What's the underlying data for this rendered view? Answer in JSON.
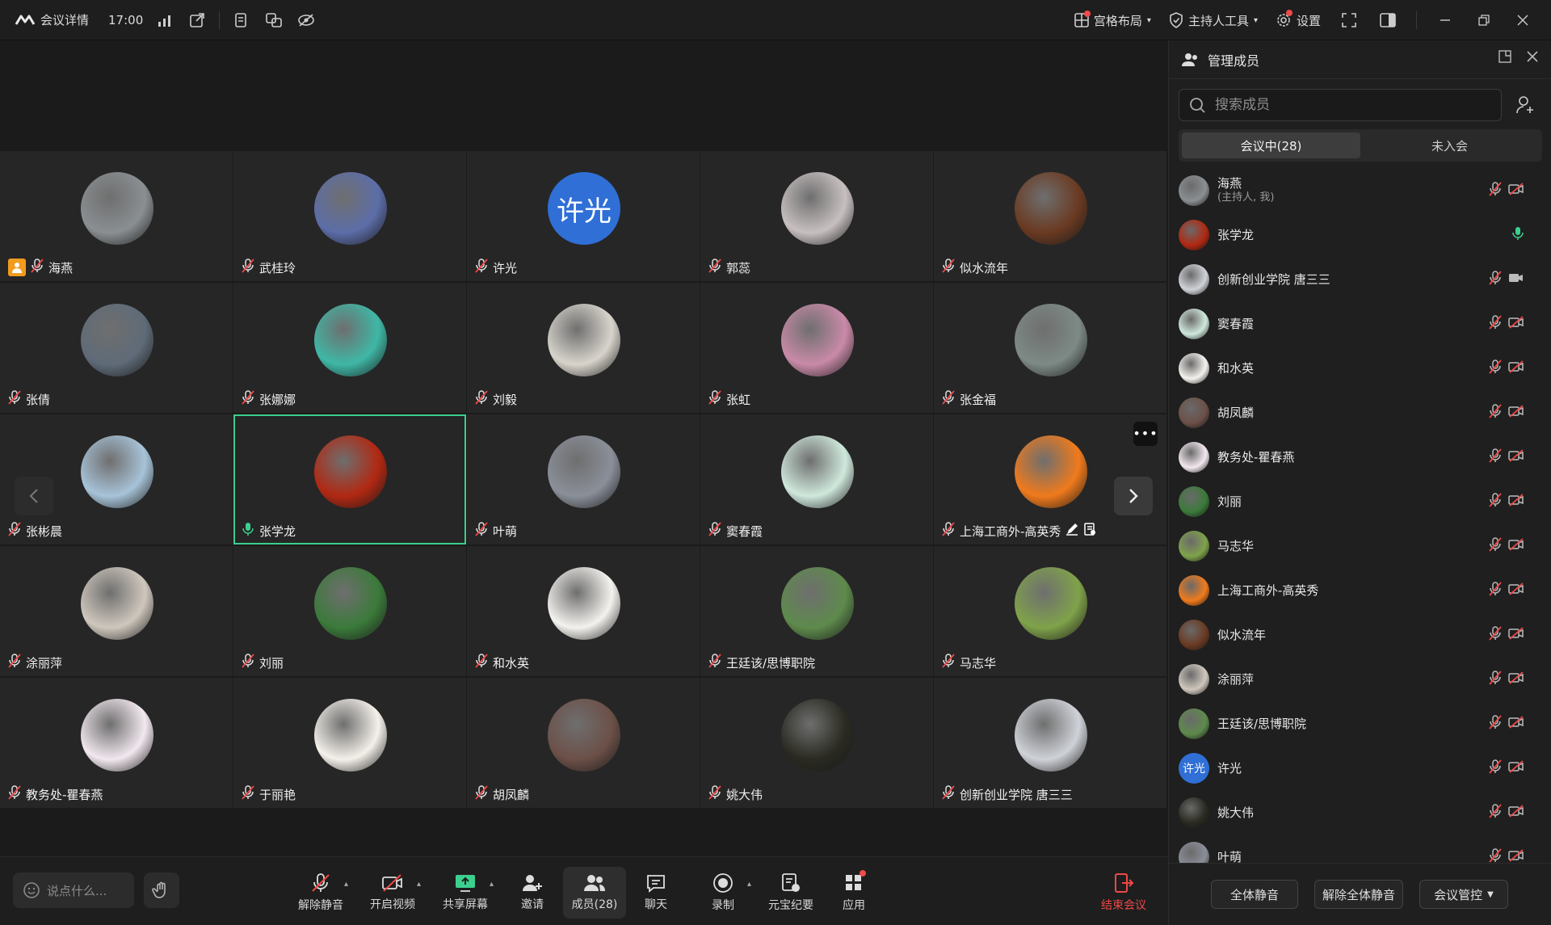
{
  "topbar": {
    "meeting_info": "会议详情",
    "time": "17:00",
    "layout": "宫格布局",
    "host_tools": "主持人工具",
    "settings": "设置"
  },
  "tiles": [
    {
      "name": "海燕",
      "color": "#8a8f92",
      "initials": "",
      "host": true
    },
    {
      "name": "武桂玲",
      "color": "#5c6da8",
      "initials": ""
    },
    {
      "name": "许光",
      "color": "#2f6fd6",
      "initials": "许光"
    },
    {
      "name": "郭蕊",
      "color": "#c8c0c0",
      "initials": ""
    },
    {
      "name": "似水流年",
      "color": "#6a3a22",
      "initials": ""
    },
    {
      "name": "张倩",
      "color": "#5f6b78",
      "initials": ""
    },
    {
      "name": "张娜娜",
      "color": "#3fb7a6",
      "initials": ""
    },
    {
      "name": "刘毅",
      "color": "#d8d4cc",
      "initials": ""
    },
    {
      "name": "张虹",
      "color": "#c98aa8",
      "initials": ""
    },
    {
      "name": "张金福",
      "color": "#7d8a86",
      "initials": ""
    },
    {
      "name": "张彬晨",
      "color": "#a7c3d8",
      "initials": ""
    },
    {
      "name": "张学龙",
      "color": "#b12812",
      "initials": "",
      "active": true,
      "speaking": true
    },
    {
      "name": "叶萌",
      "color": "#8a8f99",
      "initials": ""
    },
    {
      "name": "窦春霞",
      "color": "#cfe8dc",
      "initials": ""
    },
    {
      "name": "上海工商外-高英秀",
      "color": "#f07a1c",
      "initials": "",
      "extras": true
    },
    {
      "name": "涂丽萍",
      "color": "#cfc7bd",
      "initials": ""
    },
    {
      "name": "刘丽",
      "color": "#3b7a3a",
      "initials": ""
    },
    {
      "name": "和水英",
      "color": "#f4f2ee",
      "initials": ""
    },
    {
      "name": "王廷该/思博职院",
      "color": "#5e8a4c",
      "initials": ""
    },
    {
      "name": "马志华",
      "color": "#7fa24a",
      "initials": ""
    },
    {
      "name": "教务处-瞿春燕",
      "color": "#f2e8ef",
      "initials": ""
    },
    {
      "name": "于丽艳",
      "color": "#f4f0ea",
      "initials": ""
    },
    {
      "name": "胡凤麟",
      "color": "#6c5048",
      "initials": ""
    },
    {
      "name": "姚大伟",
      "color": "#2a2a22",
      "initials": ""
    },
    {
      "name": "创新创业学院 唐三三",
      "color": "#cfd2d8",
      "initials": ""
    }
  ],
  "bottom": {
    "chat_placeholder": "说点什么...",
    "unmute": "解除静音",
    "video": "开启视频",
    "share": "共享屏幕",
    "invite": "邀请",
    "members": "成员(28)",
    "chat": "聊天",
    "record": "录制",
    "summary": "元宝纪要",
    "apps": "应用",
    "end": "结束会议"
  },
  "panel": {
    "title": "管理成员",
    "search_placeholder": "搜索成员",
    "tab_in": "会议中(28)",
    "tab_out": "未入会",
    "mute_all": "全体静音",
    "unmute_all": "解除全体静音",
    "control": "会议管控",
    "members": [
      {
        "name": "海燕",
        "sub": "(主持人, 我)",
        "color": "#8a8f92",
        "initials": "",
        "mic": "muted",
        "cam": "off"
      },
      {
        "name": "张学龙",
        "sub": "",
        "color": "#b12812",
        "initials": "",
        "mic": "on",
        "cam": "none"
      },
      {
        "name": "创新创业学院  唐三三",
        "sub": "",
        "color": "#cfd2d8",
        "initials": "",
        "mic": "muted",
        "cam": "on"
      },
      {
        "name": "窦春霞",
        "sub": "",
        "color": "#cfe8dc",
        "initials": "",
        "mic": "muted",
        "cam": "off"
      },
      {
        "name": "和水英",
        "sub": "",
        "color": "#f4f2ee",
        "initials": "",
        "mic": "muted",
        "cam": "off"
      },
      {
        "name": "胡凤麟",
        "sub": "",
        "color": "#6c5048",
        "initials": "",
        "mic": "muted",
        "cam": "off"
      },
      {
        "name": "教务处-瞿春燕",
        "sub": "",
        "color": "#f2e8ef",
        "initials": "",
        "mic": "muted",
        "cam": "off"
      },
      {
        "name": "刘丽",
        "sub": "",
        "color": "#3b7a3a",
        "initials": "",
        "mic": "muted",
        "cam": "off"
      },
      {
        "name": "马志华",
        "sub": "",
        "color": "#7fa24a",
        "initials": "",
        "mic": "muted",
        "cam": "off"
      },
      {
        "name": "上海工商外-高英秀",
        "sub": "",
        "color": "#f07a1c",
        "initials": "",
        "mic": "muted",
        "cam": "off"
      },
      {
        "name": "似水流年",
        "sub": "",
        "color": "#6a3a22",
        "initials": "",
        "mic": "muted",
        "cam": "off"
      },
      {
        "name": "涂丽萍",
        "sub": "",
        "color": "#cfc7bd",
        "initials": "",
        "mic": "muted",
        "cam": "off"
      },
      {
        "name": "王廷该/思博职院",
        "sub": "",
        "color": "#5e8a4c",
        "initials": "",
        "mic": "muted",
        "cam": "off"
      },
      {
        "name": "许光",
        "sub": "",
        "color": "#2f6fd6",
        "initials": "许光",
        "mic": "muted",
        "cam": "off"
      },
      {
        "name": "姚大伟",
        "sub": "",
        "color": "#2a2a22",
        "initials": "",
        "mic": "muted",
        "cam": "off"
      },
      {
        "name": "叶萌",
        "sub": "",
        "color": "#8a8f99",
        "initials": "",
        "mic": "muted",
        "cam": "off"
      }
    ]
  },
  "colors": {
    "accent_green": "#3ccf8e",
    "end_red": "#f04848",
    "host_badge": "#f29b1d"
  }
}
